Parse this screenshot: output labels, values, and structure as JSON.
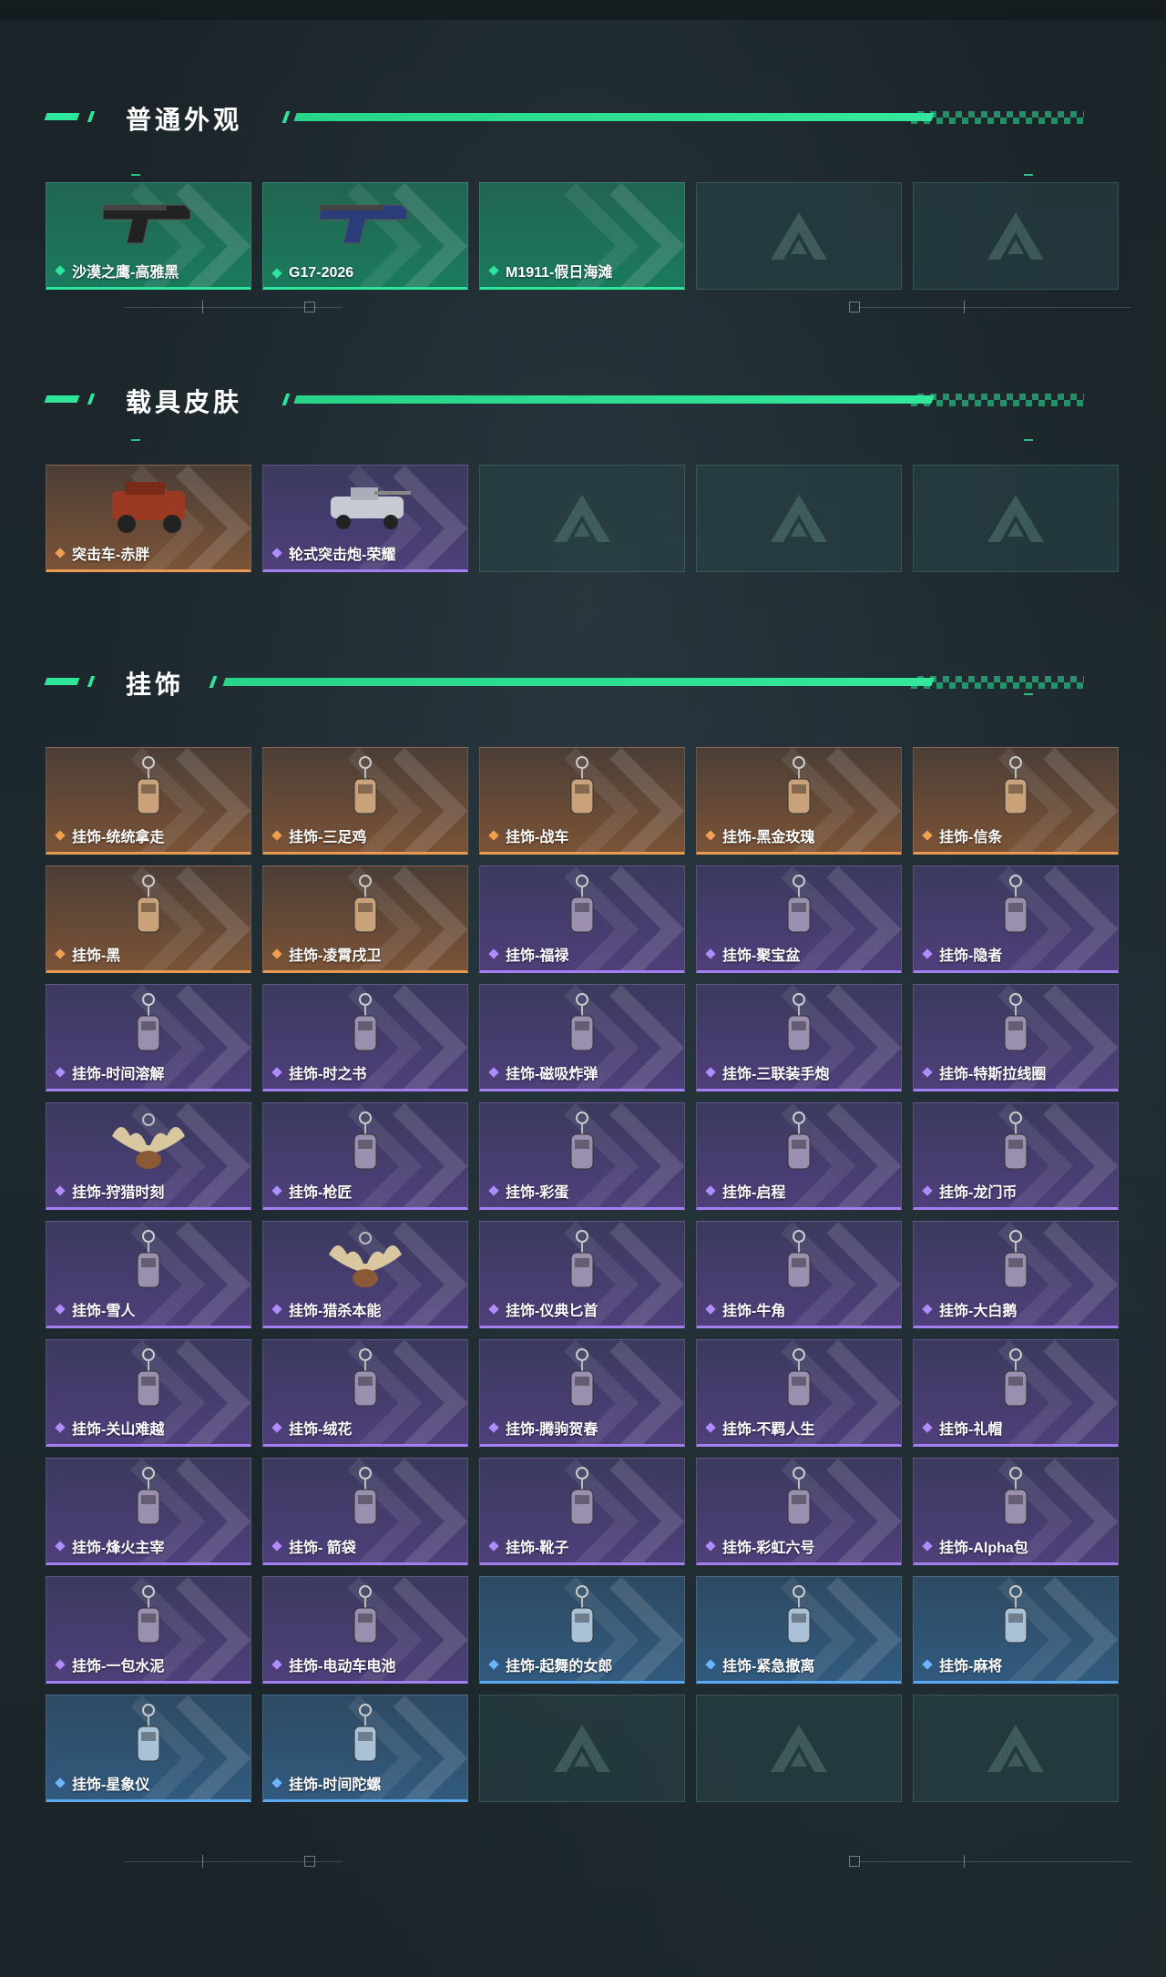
{
  "sections": {
    "weapons": {
      "title": "普通外观",
      "items": [
        {
          "label": "沙漠之鹰-高雅黑",
          "rarity": "green",
          "icon": "pistol-black-icon"
        },
        {
          "label": "G17-2026",
          "rarity": "green",
          "icon": "pistol-blue-icon"
        },
        {
          "label": "M1911-假日海滩",
          "rarity": "green",
          "icon": "pistol-icon"
        },
        {
          "label": "",
          "rarity": "empty",
          "icon": "logo-placeholder-icon"
        },
        {
          "label": "",
          "rarity": "empty",
          "icon": "logo-placeholder-icon"
        }
      ]
    },
    "vehicles": {
      "title": "载具皮肤",
      "items": [
        {
          "label": "突击车-赤胖",
          "rarity": "orange",
          "icon": "assault-vehicle-icon"
        },
        {
          "label": "轮式突击炮-荣耀",
          "rarity": "purple",
          "icon": "wheeled-assault-gun-icon"
        },
        {
          "label": "",
          "rarity": "empty",
          "icon": "logo-placeholder-icon"
        },
        {
          "label": "",
          "rarity": "empty",
          "icon": "logo-placeholder-icon"
        },
        {
          "label": "",
          "rarity": "empty",
          "icon": "logo-placeholder-icon"
        }
      ]
    },
    "charms": {
      "title": "挂饰",
      "items": [
        {
          "label": "挂饰-统统拿走",
          "rarity": "orange",
          "icon": "charm-icon"
        },
        {
          "label": "挂饰-三足鸡",
          "rarity": "orange",
          "icon": "charm-icon"
        },
        {
          "label": "挂饰-战车",
          "rarity": "orange",
          "icon": "charm-icon"
        },
        {
          "label": "挂饰-黑金玫瑰",
          "rarity": "orange",
          "icon": "charm-icon"
        },
        {
          "label": "挂饰-信条",
          "rarity": "orange",
          "icon": "charm-icon"
        },
        {
          "label": "挂饰-黑",
          "rarity": "orange",
          "icon": "charm-icon"
        },
        {
          "label": "挂饰-凌霄戌卫",
          "rarity": "orange",
          "icon": "charm-icon"
        },
        {
          "label": "挂饰-福禄",
          "rarity": "purple",
          "icon": "charm-icon"
        },
        {
          "label": "挂饰-聚宝盆",
          "rarity": "purple",
          "icon": "charm-icon"
        },
        {
          "label": "挂饰-隐者",
          "rarity": "purple",
          "icon": "charm-icon"
        },
        {
          "label": "挂饰-时间溶解",
          "rarity": "purple",
          "icon": "charm-icon"
        },
        {
          "label": "挂饰-时之书",
          "rarity": "purple",
          "icon": "charm-icon"
        },
        {
          "label": "挂饰-磁吸炸弹",
          "rarity": "purple",
          "icon": "charm-icon"
        },
        {
          "label": "挂饰-三联装手炮",
          "rarity": "purple",
          "icon": "charm-icon"
        },
        {
          "label": "挂饰-特斯拉线圈",
          "rarity": "purple",
          "icon": "charm-icon"
        },
        {
          "label": "挂饰-狩猎时刻",
          "rarity": "purple",
          "icon": "antler-charm-icon"
        },
        {
          "label": "挂饰-枪匠",
          "rarity": "purple",
          "icon": "charm-icon"
        },
        {
          "label": "挂饰-彩蛋",
          "rarity": "purple",
          "icon": "egg-charm-icon"
        },
        {
          "label": "挂饰-启程",
          "rarity": "purple",
          "icon": "charm-icon"
        },
        {
          "label": "挂饰-龙门币",
          "rarity": "purple",
          "icon": "charm-icon"
        },
        {
          "label": "挂饰-雪人",
          "rarity": "purple",
          "icon": "snowman-charm-icon"
        },
        {
          "label": "挂饰-猎杀本能",
          "rarity": "purple",
          "icon": "antler-charm-icon"
        },
        {
          "label": "挂饰-仪典匕首",
          "rarity": "purple",
          "icon": "dagger-charm-icon"
        },
        {
          "label": "挂饰-牛角",
          "rarity": "purple",
          "icon": "horn-charm-icon"
        },
        {
          "label": "挂饰-大白鹅",
          "rarity": "purple",
          "icon": "goose-charm-icon"
        },
        {
          "label": "挂饰-关山难越",
          "rarity": "purple",
          "icon": "charm-icon"
        },
        {
          "label": "挂饰-绒花",
          "rarity": "purple",
          "icon": "flower-charm-icon"
        },
        {
          "label": "挂饰-腾驹贺春",
          "rarity": "purple",
          "icon": "carriage-charm-icon"
        },
        {
          "label": "挂饰-不羁人生",
          "rarity": "purple",
          "icon": "shoe-charm-icon"
        },
        {
          "label": "挂饰-礼帽",
          "rarity": "purple",
          "icon": "hat-charm-icon"
        },
        {
          "label": "挂饰-烽火主宰",
          "rarity": "purple",
          "icon": "charm-icon"
        },
        {
          "label": "挂饰- 箭袋",
          "rarity": "purple",
          "icon": "charm-icon"
        },
        {
          "label": "挂饰-靴子",
          "rarity": "purple",
          "icon": "boot-charm-icon"
        },
        {
          "label": "挂饰-彩虹六号",
          "rarity": "purple",
          "icon": "charm-icon"
        },
        {
          "label": "挂饰-Alpha包",
          "rarity": "purple",
          "icon": "charm-icon"
        },
        {
          "label": "挂饰-一包水泥",
          "rarity": "purple",
          "icon": "charm-icon"
        },
        {
          "label": "挂饰-电动车电池",
          "rarity": "purple",
          "icon": "battery-charm-icon"
        },
        {
          "label": "挂饰-起舞的女郎",
          "rarity": "blue",
          "icon": "charm-icon"
        },
        {
          "label": "挂饰-紧急撤离",
          "rarity": "blue",
          "icon": "charm-icon"
        },
        {
          "label": "挂饰-麻将",
          "rarity": "blue",
          "icon": "mahjong-charm-icon"
        },
        {
          "label": "挂饰-星象仪",
          "rarity": "blue",
          "icon": "astrolabe-charm-icon"
        },
        {
          "label": "挂饰-时间陀螺",
          "rarity": "blue",
          "icon": "charm-icon"
        },
        {
          "label": "",
          "rarity": "empty",
          "icon": "logo-placeholder-icon"
        },
        {
          "label": "",
          "rarity": "empty",
          "icon": "logo-placeholder-icon"
        },
        {
          "label": "",
          "rarity": "empty",
          "icon": "logo-placeholder-icon"
        }
      ]
    }
  },
  "colors": {
    "accent": "#2ee69a",
    "orange": "#e89a52",
    "purple": "#a37ff0",
    "blue": "#5aa8f0"
  }
}
